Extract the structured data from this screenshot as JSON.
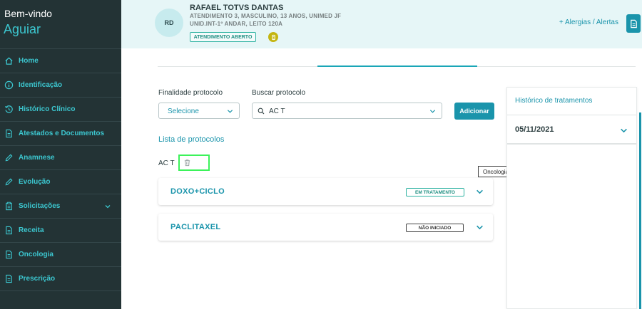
{
  "sidebar": {
    "welcome": "Bem-vindo",
    "user": "Aguiar",
    "items": [
      {
        "label": "Home",
        "icon": "home-icon"
      },
      {
        "label": "Identificação",
        "icon": "info-icon"
      },
      {
        "label": "Histórico Clínico",
        "icon": "history-icon"
      },
      {
        "label": "Atestados e Documentos",
        "icon": "document-icon"
      },
      {
        "label": "Anamnese",
        "icon": "pencil-icon"
      },
      {
        "label": "Evolução",
        "icon": "pencil-icon"
      },
      {
        "label": "Solicitações",
        "icon": "clipboard-icon"
      },
      {
        "label": "Receita",
        "icon": "document-icon"
      },
      {
        "label": "Oncologia",
        "icon": "document-icon"
      },
      {
        "label": "Prescrição",
        "icon": "document-icon"
      }
    ]
  },
  "header": {
    "initials": "RD",
    "patient_name": "RAFAEL TOTVS DANTAS",
    "line1": "ATENDIMENTO 3, MASCULINO, 13 ANOS, UNIMED JF",
    "line2": "UNID.INT-1º ANDAR, LEITO 120A",
    "status_badge": "ATENDIMENTO ABERTO",
    "allergies_link": "+ Alergias / Alertas"
  },
  "form": {
    "finalidade_label": "Finalidade protocolo",
    "finalidade_value": "Selecione",
    "buscar_label": "Buscar protocolo",
    "buscar_value": "AC T",
    "add_button": "Adicionar"
  },
  "protocol_list": {
    "title": "Lista de protocolos",
    "selected": "AC T",
    "tooltip": "Oncologia",
    "items": [
      {
        "name": "DOXO+CICLO",
        "status": "EM TRATAMENTO"
      },
      {
        "name": "PACLITAXEL",
        "status": "NÃO INICIADO"
      }
    ]
  },
  "history": {
    "title": "Histórico de tratamentos",
    "entries": [
      {
        "date": "05/11/2021"
      }
    ]
  },
  "colors": {
    "sidebar_bg": "#233335",
    "accent": "#1a94ab",
    "header_bg": "#e6f6f7",
    "highlight": "#3cf25a"
  }
}
